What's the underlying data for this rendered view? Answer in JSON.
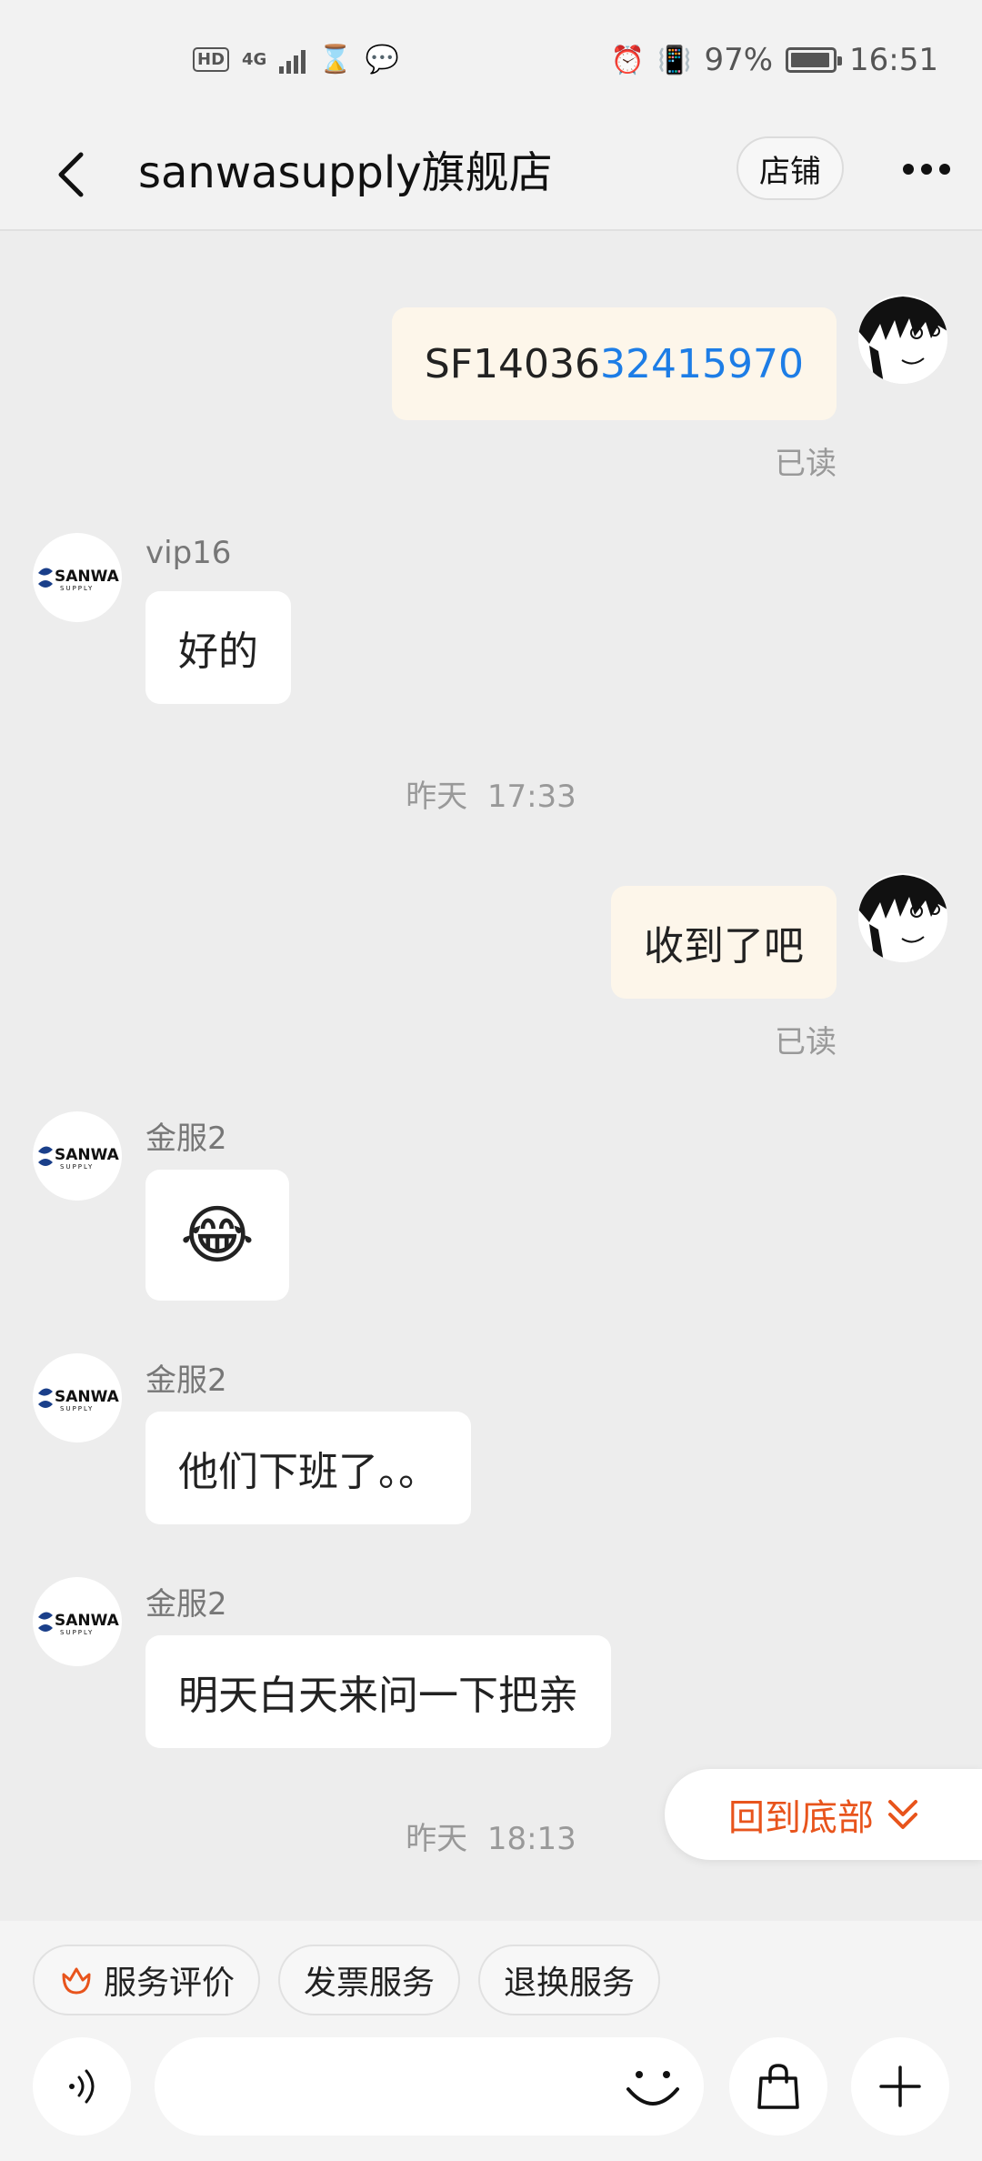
{
  "status_bar": {
    "left_badges": [
      "HD",
      "4G"
    ],
    "battery_percent": "97%",
    "time": "16:51"
  },
  "nav": {
    "title": "sanwasupply旗舰店",
    "store_label": "店铺"
  },
  "messages": [
    {
      "from": "me",
      "text_plain": "SF14036",
      "text_link": "32415970",
      "read": "已读"
    },
    {
      "from": "them",
      "sender": "vip16",
      "text": "好的"
    },
    {
      "type": "timestamp",
      "day": "昨天",
      "time": "17:33"
    },
    {
      "from": "me",
      "text": "收到了吧",
      "read": "已读"
    },
    {
      "from": "them",
      "sender": "金服2",
      "emoji": "😂"
    },
    {
      "from": "them",
      "sender": "金服2",
      "text": "他们下班了。。"
    },
    {
      "from": "them",
      "sender": "金服2",
      "text": "明天白天来问一下把亲"
    },
    {
      "type": "timestamp",
      "day": "昨天",
      "time": "18:13"
    }
  ],
  "scroll_to_bottom": {
    "label": "回到底部"
  },
  "quick_actions": [
    "服务评价",
    "发票服务",
    "退换服务"
  ],
  "input": {
    "placeholder": ""
  },
  "colors": {
    "accent": "#e8541c",
    "link": "#1d7de6",
    "my_bubble": "#fdf6ea"
  },
  "shop_logo_text": {
    "top": "SANWA",
    "bottom": "SUPPLY"
  }
}
